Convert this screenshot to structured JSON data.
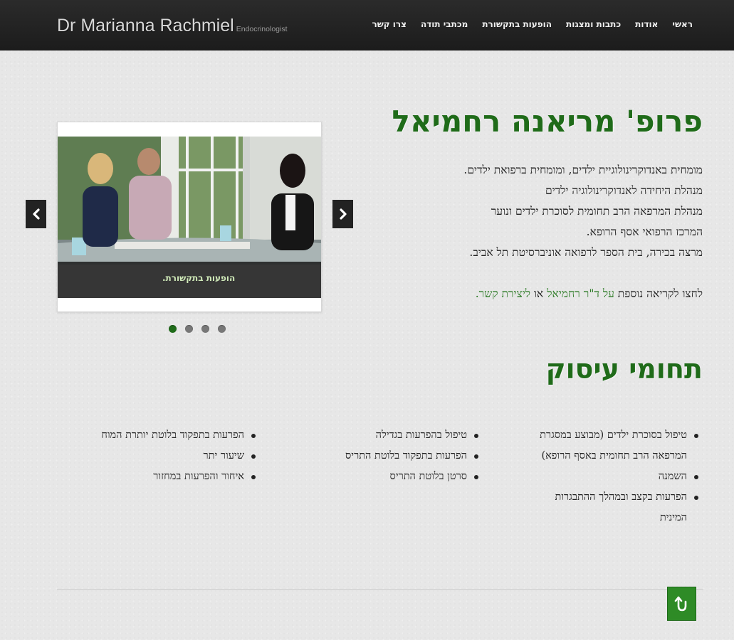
{
  "header": {
    "brand_name": "Dr Marianna Rachmiel",
    "brand_subtitle": "Endocrinologist",
    "nav": [
      "ראשי",
      "אודות",
      "כתבות ומצגות",
      "הופעות בתקשורת",
      "מכתבי תודה",
      "צרו קשר"
    ]
  },
  "hero": {
    "title": "פרופ' מריאנה רחמיאל",
    "bio_lines": [
      "מומחית באנדוקרינולוגיית ילדים, ומומחית ברפואת ילדים.",
      "מנהלת היחידה לאנדוקרינולוגיה ילדים",
      "מנהלת המרפאה הרב תחומית לסוכרת ילדים ונוער",
      "המרכז הרפואי אסף הרופא.",
      "מרצה בכירה, בית הספר לרפואה אוניברסיטת תל אביב."
    ],
    "cta_prefix": "לחצו לקריאה נוספת",
    "cta_link1": "על ד\"ר רחמיאל",
    "cta_middle": "או",
    "cta_link2": "ליצירת קשר."
  },
  "slider": {
    "caption": "הופעות בתקשורת.",
    "prev_icon": "chevron-left-icon",
    "next_icon": "chevron-right-icon",
    "dots": 4,
    "active_dot": 0
  },
  "practice": {
    "title": "תחומי עיסוק",
    "col1": [
      "טיפול בסוכרת ילדים (מבוצע במסגרת המרפאה הרב תחומית באסף הרופא)",
      "השמנה",
      "הפרעות בקצב ובמהלך ההתבגרות המינית"
    ],
    "col2": [
      "טיפול בהפרעות בגדילה",
      "הפרעות בתפקוד בלוטת התריס",
      "סרטן בלוטת התריס"
    ],
    "col3": [
      "הפרעות בתפקוד בלוטת יותרת המוח",
      "שיעור יתר",
      "איחור והפרעות במחזור"
    ]
  },
  "footer": {
    "top_icon": "scroll-to-top-icon"
  },
  "colors": {
    "accent": "#1f6b19",
    "topbar": "#222222",
    "link": "#2b7a24"
  }
}
